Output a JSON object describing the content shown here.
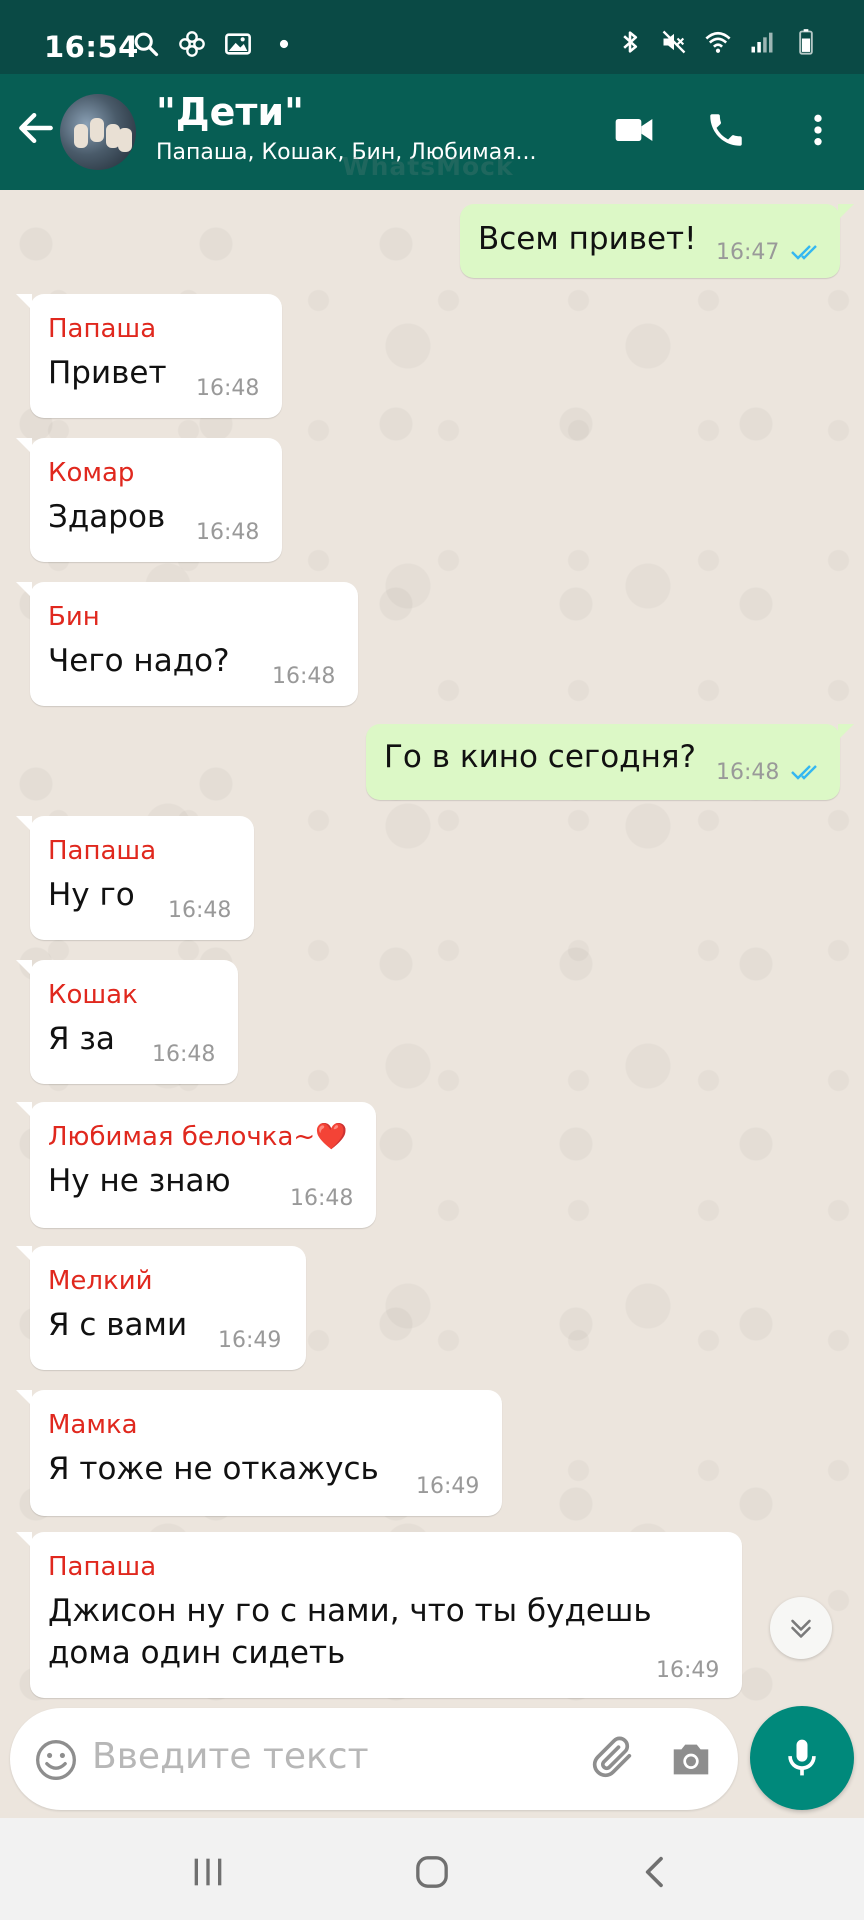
{
  "status_bar": {
    "time": "16:54",
    "left_icons": [
      "search-icon",
      "pinwheel-icon",
      "image-icon",
      "dot-icon"
    ],
    "right_icons": [
      "bluetooth-icon",
      "mute-icon",
      "wifi-icon",
      "signal-icon",
      "battery-icon"
    ]
  },
  "header": {
    "title": "\"Дети\"",
    "subtitle": "Папаша, Кошак, Бин, Любимая...",
    "watermark": "WhatsMock"
  },
  "messages": [
    {
      "dir": "out",
      "text": "Всем привет!",
      "time": "16:47",
      "status": "read"
    },
    {
      "dir": "in",
      "sender": "Папаша",
      "text": "Привет",
      "time": "16:48"
    },
    {
      "dir": "in",
      "sender": "Комар",
      "text": "Здаров",
      "time": "16:48"
    },
    {
      "dir": "in",
      "sender": "Бин",
      "text": "Чего надо?",
      "time": "16:48"
    },
    {
      "dir": "out",
      "text": "Го в кино сегодня?",
      "time": "16:48",
      "status": "read"
    },
    {
      "dir": "in",
      "sender": "Папаша",
      "text": "Ну го",
      "time": "16:48"
    },
    {
      "dir": "in",
      "sender": "Кошак",
      "text": "Я за",
      "time": "16:48"
    },
    {
      "dir": "in",
      "sender": "Любимая белочка~❤️",
      "text": "Ну не знаю",
      "time": "16:48"
    },
    {
      "dir": "in",
      "sender": "Мелкий",
      "text": "Я с вами",
      "time": "16:49"
    },
    {
      "dir": "in",
      "sender": "Мамка",
      "text": "Я тоже не откажусь",
      "time": "16:49"
    },
    {
      "dir": "in",
      "sender": "Папаша",
      "text_lines": [
        "Джисон ну го с нами, что ты будешь",
        "дома один сидеть"
      ],
      "time": "16:49"
    }
  ],
  "input": {
    "placeholder": "Введите текст"
  },
  "colors": {
    "header": "#075e54",
    "status_bar": "#0a4a45",
    "outgoing_bubble": "#dcf8c6",
    "incoming_bubble": "#ffffff",
    "sender_name": "#e0281e",
    "mic_button": "#00897b",
    "read_ticks": "#34b7f1"
  },
  "nav_icons": [
    "recents-icon",
    "home-icon",
    "back-icon"
  ]
}
